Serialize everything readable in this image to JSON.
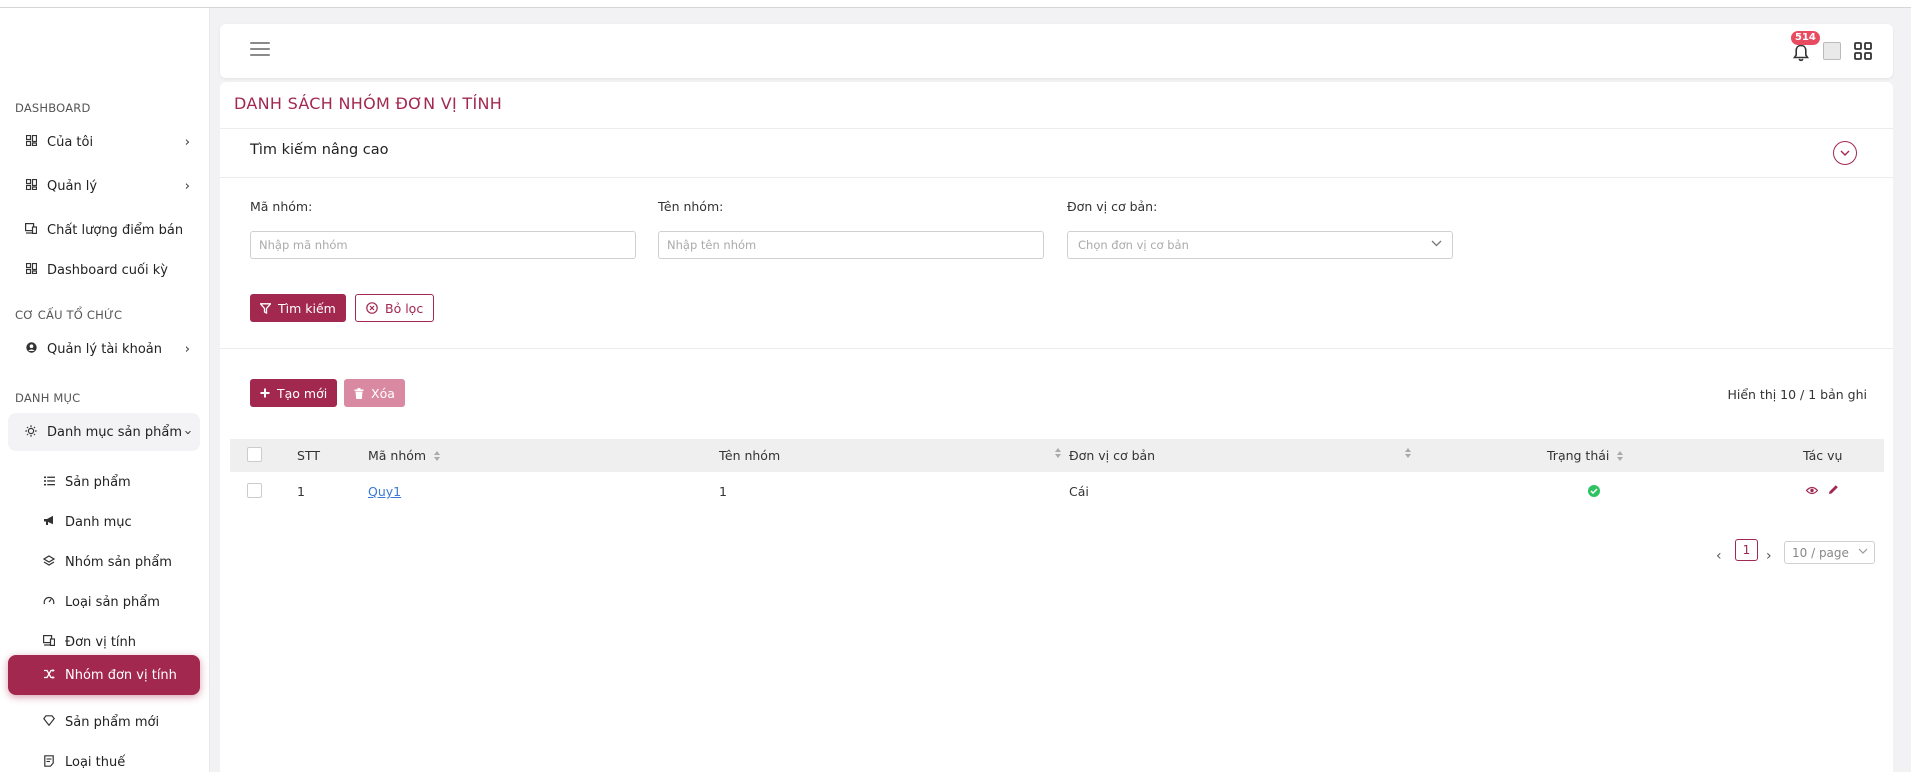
{
  "sidebar": {
    "sections": [
      {
        "title": "DASHBOARD"
      },
      {
        "title": "CƠ CẤU TỔ CHỨC"
      },
      {
        "title": "DANH MỤC"
      }
    ],
    "items": [
      {
        "label": "Của tôi",
        "icon": "dashboard-grid-icon"
      },
      {
        "label": "Quản lý",
        "icon": "dashboard-grid-icon"
      },
      {
        "label": "Chất lượng điểm bán",
        "icon": "devices-icon"
      },
      {
        "label": "Dashboard cuối kỳ",
        "icon": "dashboard-grid-icon"
      },
      {
        "label": "Quản lý tài khoản",
        "icon": "user-circle-icon"
      },
      {
        "label": "Danh mục sản phẩm",
        "icon": "bulb-icon"
      },
      {
        "label": "Sản phẩm",
        "icon": "list-icon"
      },
      {
        "label": "Danh mục",
        "icon": "megaphone-icon"
      },
      {
        "label": "Nhóm sản phẩm",
        "icon": "layers-icon"
      },
      {
        "label": "Loại sản phẩm",
        "icon": "dashboard-gauge-icon"
      },
      {
        "label": "Đơn vị tính",
        "icon": "devices-icon"
      },
      {
        "label": "Nhóm đơn vị tính",
        "icon": "shuffle-icon"
      },
      {
        "label": "Sản phẩm mới",
        "icon": "diamond-icon"
      },
      {
        "label": "Loại thuế",
        "icon": "receipt-icon"
      }
    ]
  },
  "header": {
    "notification_count": "514"
  },
  "page": {
    "title": "DANH SÁCH NHÓM ĐƠN VỊ TÍNH",
    "advanced_search": "Tìm kiếm nâng cao"
  },
  "filters": {
    "group_code_label": "Mã nhóm:",
    "group_code_placeholder": "Nhập mã nhóm",
    "group_name_label": "Tên nhóm:",
    "group_name_placeholder": "Nhập tên nhóm",
    "base_unit_label": "Đơn vị cơ bản:",
    "base_unit_placeholder": "Chọn đơn vị cơ bản",
    "search_button": "Tìm kiếm",
    "clear_button": "Bỏ lọc"
  },
  "actions": {
    "create_button": "Tạo mới",
    "delete_button": "Xóa",
    "record_info": "Hiển thị 10 / 1 bản ghi"
  },
  "table": {
    "columns": [
      "STT",
      "Mã nhóm",
      "Tên nhóm",
      "Đơn vị cơ bản",
      "Trạng thái",
      "Tác vụ"
    ],
    "rows": [
      {
        "stt": "1",
        "code": "Quy1",
        "name": "1",
        "base_unit": "Cái",
        "status": "active"
      }
    ]
  },
  "pagination": {
    "current_page": "1",
    "page_size": "10 / page"
  },
  "colors": {
    "brand": "#a3284f",
    "status_active": "#2fc262",
    "link": "#3a79d6"
  }
}
